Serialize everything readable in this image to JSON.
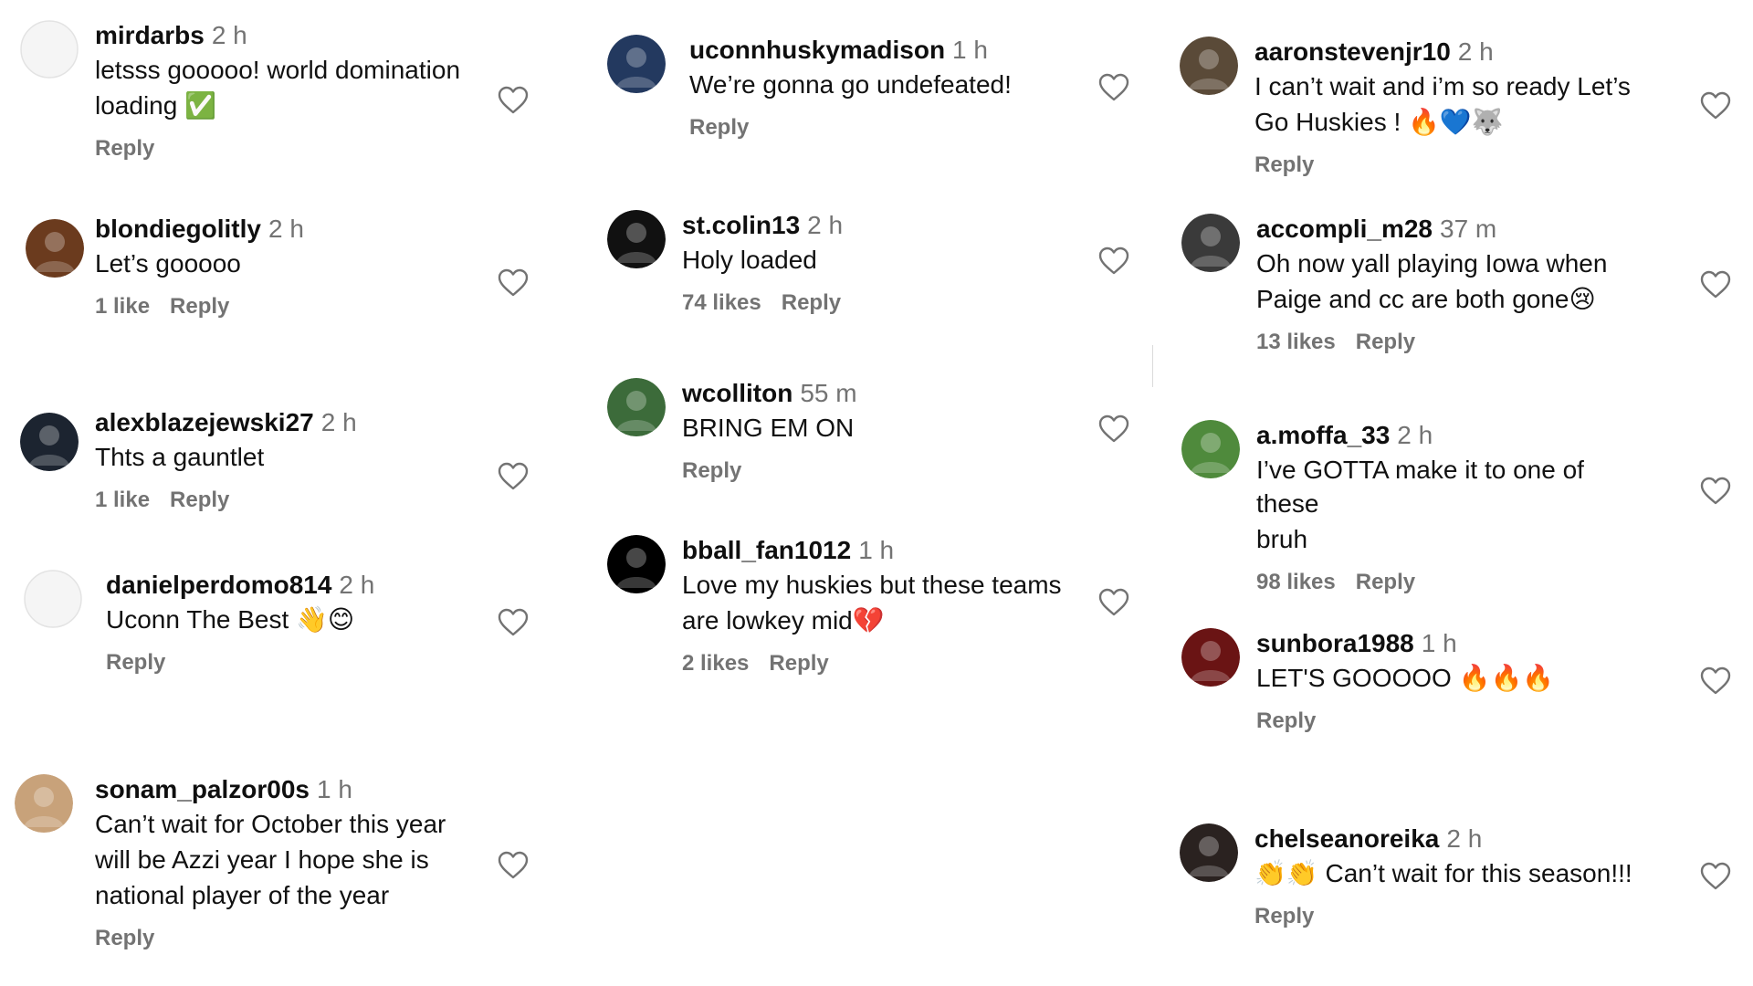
{
  "columns": [
    [
      {
        "user": "mirdarbs",
        "time": "2 h",
        "lines": [
          "letsss gooooo! world domination",
          "loading ✅"
        ],
        "likes": "",
        "reply": "Reply"
      },
      {
        "user": "blondiegolitly",
        "time": "2 h",
        "lines": [
          "Let’s gooooo"
        ],
        "likes": "1 like",
        "reply": "Reply"
      },
      {
        "user": "alexblazejewski27",
        "time": "2 h",
        "lines": [
          "Thts a gauntlet"
        ],
        "likes": "1 like",
        "reply": "Reply"
      },
      {
        "user": "danielperdomo814",
        "time": "2 h",
        "lines": [
          "Uconn The Best 👋😊"
        ],
        "likes": "",
        "reply": "Reply"
      },
      {
        "user": "sonam_palzor00s",
        "time": "1 h",
        "lines": [
          "Can’t wait for October this year",
          "will be Azzi year I hope she is",
          "national player of the year"
        ],
        "likes": "",
        "reply": "Reply"
      }
    ],
    [
      {
        "user": "uconnhuskymadison",
        "time": "1 h",
        "lines": [
          "We’re gonna go undefeated!"
        ],
        "likes": "",
        "reply": "Reply"
      },
      {
        "user": "st.colin13",
        "time": "2 h",
        "lines": [
          "Holy loaded"
        ],
        "likes": "74 likes",
        "reply": "Reply"
      },
      {
        "user": "wcolliton",
        "time": "55 m",
        "lines": [
          "BRING EM ON"
        ],
        "likes": "",
        "reply": "Reply"
      },
      {
        "user": "bball_fan1012",
        "time": "1 h",
        "lines": [
          "Love my huskies but these teams",
          "are lowkey mid💔"
        ],
        "likes": "2 likes",
        "reply": "Reply"
      }
    ],
    [
      {
        "user": "aaronstevenjr10",
        "time": "2 h",
        "lines": [
          "I can’t wait and i’m so ready Let’s",
          "Go Huskies ! 🔥💙🐺"
        ],
        "likes": "",
        "reply": "Reply"
      },
      {
        "user": "accompli_m28",
        "time": "37 m",
        "lines": [
          "Oh now yall playing Iowa when",
          "Paige and cc are both gone😢"
        ],
        "likes": "13 likes",
        "reply": "Reply"
      },
      {
        "user": "a.moffa_33",
        "time": "2 h",
        "lines": [
          "I’ve GOTTA make it to one of these",
          "bruh"
        ],
        "likes": "98 likes",
        "reply": "Reply"
      },
      {
        "user": "sunbora1988",
        "time": "1 h",
        "lines": [
          "LET'S GOOOOO 🔥🔥🔥"
        ],
        "likes": "",
        "reply": "Reply"
      },
      {
        "user": "chelseanoreika",
        "time": "2 h",
        "lines": [
          "👏👏 Can’t wait for this season!!!"
        ],
        "likes": "",
        "reply": "Reply"
      }
    ]
  ],
  "icons": {
    "like": "heart-outline-icon",
    "avatar": "profile-avatar-icon"
  },
  "colors": {
    "username": "#0f0f0f",
    "secondary": "#737373",
    "heart": "#737373",
    "background": "#ffffff",
    "divider": "#dbdbdb"
  }
}
